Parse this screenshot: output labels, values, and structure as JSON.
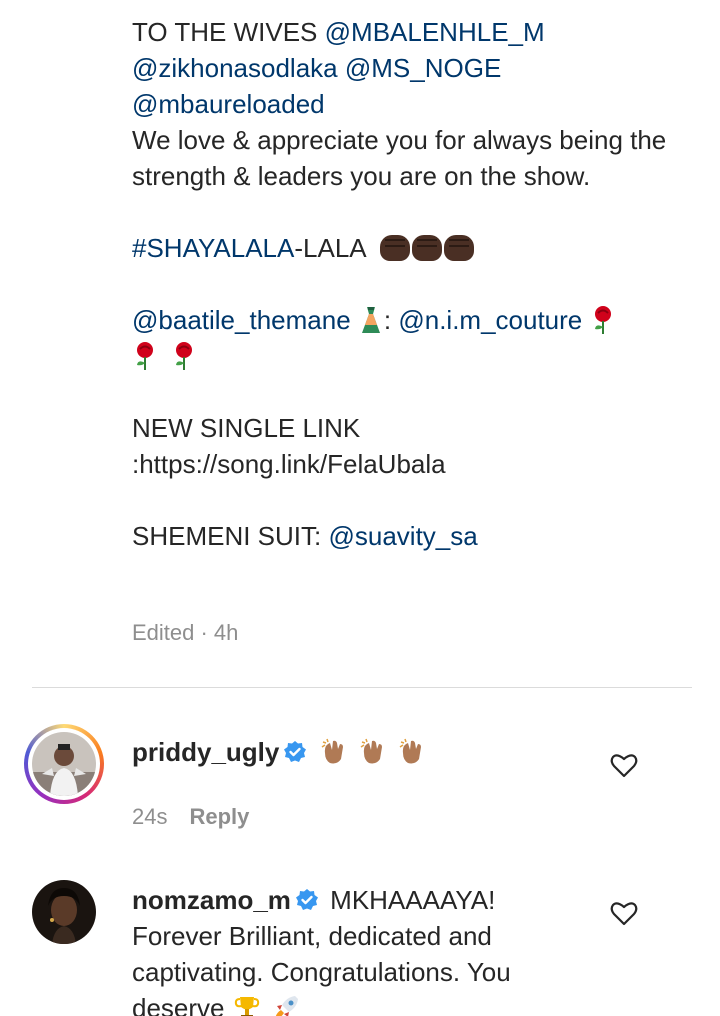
{
  "post": {
    "caption_line1_prefix": "TO THE WIVES ",
    "mention1": "@MBALENHLE_M",
    "mention2": "@zikhonasodlaka",
    "mention3": "@MS_NOGE",
    "mention4": "@mbaureloaded",
    "text1": "We love & appreciate you for always being the strength & leaders you are on the show.",
    "hashtag": "#SHAYALALA",
    "hashtag_suffix": "-LALA",
    "mention5": "@baatile_themane",
    "colon1": ": ",
    "mention6": "@n.i.m_couture",
    "single_label": "NEW SINGLE LINK",
    "single_link": ":https://song.link/FelaUbala",
    "suit_label": "SHEMENI SUIT: ",
    "mention7": "@suavity_sa",
    "meta": "Edited · 4h"
  },
  "comments": [
    {
      "username": "priddy_ugly",
      "verified": true,
      "text": "",
      "emojis": "clapping-hands x3",
      "time": "24s",
      "reply_label": "Reply"
    },
    {
      "username": "nomzamo_m",
      "verified": true,
      "text_first": "MKHAAAAYA!",
      "text_rest": "Forever Brilliant, dedicated and captivating. Congratulations. You deserve",
      "emojis": "trophy, rocket"
    }
  ],
  "colors": {
    "text": "#262626",
    "link": "#00376b",
    "muted": "#8e8e8e",
    "verified": "#3897f0",
    "divider": "#dbdbdb"
  }
}
